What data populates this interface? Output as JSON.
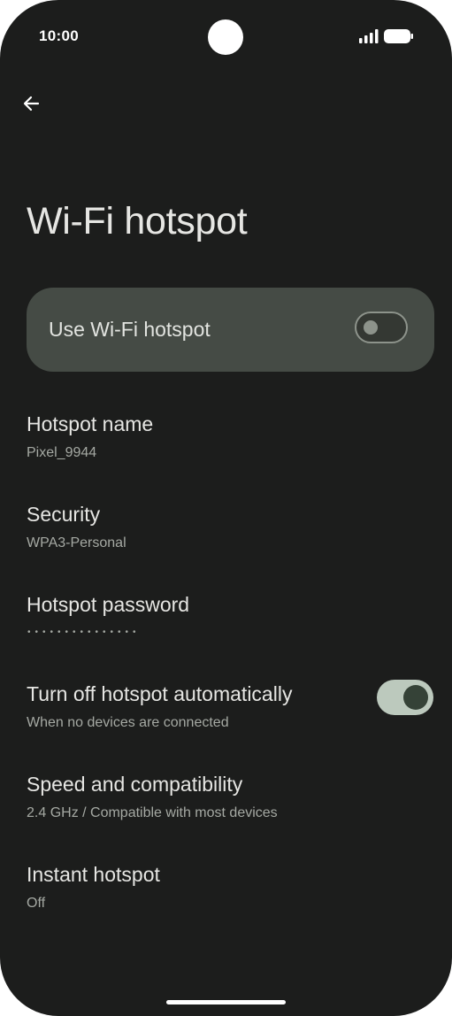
{
  "status_bar": {
    "time": "10:00",
    "signal_icon": "signal-bars-icon",
    "battery_icon": "battery-full-icon"
  },
  "header": {
    "back_icon": "arrow-back-icon",
    "title": "Wi-Fi hotspot"
  },
  "main_toggle": {
    "label": "Use Wi-Fi hotspot",
    "enabled": false
  },
  "settings": [
    {
      "title": "Hotspot name",
      "subtitle": "Pixel_9944"
    },
    {
      "title": "Security",
      "subtitle": "WPA3-Personal"
    },
    {
      "title": "Hotspot password",
      "subtitle": "•••••••••••••••"
    },
    {
      "title": "Turn off hotspot automatically",
      "subtitle": "When no devices are connected",
      "enabled": true
    },
    {
      "title": "Speed and compatibility",
      "subtitle": "2.4 GHz / Compatible with most devices"
    },
    {
      "title": "Instant hotspot",
      "subtitle": "Off"
    }
  ],
  "colors": {
    "background": "#1c1d1c",
    "card": "#454b45",
    "primary_text": "#e6e6e3",
    "secondary_text": "#a5a9a3",
    "switch_on_track": "#bcc9bd",
    "switch_on_thumb": "#354237"
  }
}
